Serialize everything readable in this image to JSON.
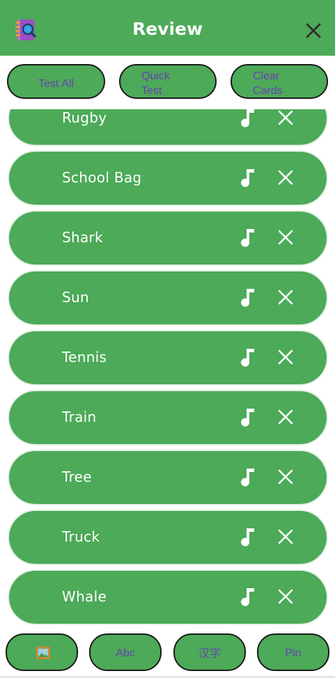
{
  "header": {
    "title": "Review",
    "logo_icon": "notebook-search-icon",
    "close_icon": "close-icon"
  },
  "toolbar": {
    "test_all_label": "Test All",
    "quick_test_label": "Quick Test",
    "quick_test_line1": "Quick",
    "quick_test_line2": "Test",
    "clear_cards_line1": "Clear",
    "clear_cards_line2": "Cards"
  },
  "words": [
    {
      "label": "Rugby"
    },
    {
      "label": "School Bag"
    },
    {
      "label": "Shark"
    },
    {
      "label": "Sun"
    },
    {
      "label": "Tennis"
    },
    {
      "label": "Train"
    },
    {
      "label": "Tree"
    },
    {
      "label": "Truck"
    },
    {
      "label": "Whale"
    }
  ],
  "item_icons": {
    "audio": "music-note-icon",
    "remove": "close-icon"
  },
  "bottom_bar": {
    "image_icon": "framed-picture-icon",
    "abc_label": "Abc",
    "hanzi_label": "汉字",
    "pin_label": "Pin"
  },
  "colors": {
    "primary_green": "#4caa58",
    "button_text": "#6a3fb6",
    "white": "#ffffff"
  }
}
